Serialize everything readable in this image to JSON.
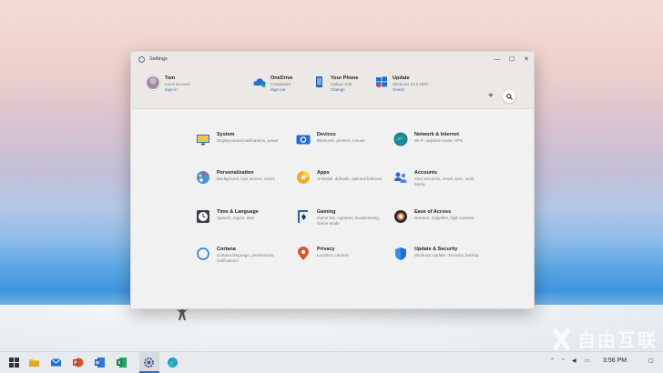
{
  "window": {
    "title": "Settings",
    "controls": {
      "minimize": "—",
      "maximize": "☐",
      "close": "✕"
    }
  },
  "header": {
    "user": {
      "name": "Tom",
      "account_type": "Local account",
      "link": "Sign in"
    },
    "items": [
      {
        "name": "OneDrive",
        "status": "Completed",
        "link": "Sign out"
      },
      {
        "name": "Your Phone",
        "status": "Galaxy S20",
        "link": "Change"
      },
      {
        "name": "Update",
        "status": "Windows 10.0.1807",
        "link": "Check"
      }
    ],
    "add_label": "+",
    "search_icon": "search-icon"
  },
  "categories": [
    {
      "name": "System",
      "desc": "Display,sound,notifications, power",
      "icon": "system-icon"
    },
    {
      "name": "Devices",
      "desc": "Bluetooth, printers, mouse",
      "icon": "devices-icon"
    },
    {
      "name": "Network & Internet",
      "desc": "Wi-Fi, airplane mode, VPN",
      "icon": "network-icon"
    },
    {
      "name": "Personalization",
      "desc": "Background, lock screen, colors",
      "icon": "personalization-icon"
    },
    {
      "name": "Apps",
      "desc": "Uninstall, defaults, optional features",
      "icon": "apps-icon"
    },
    {
      "name": "Accounts",
      "desc": "Your accounts, email, sync, work, family",
      "icon": "accounts-icon"
    },
    {
      "name": "Time & Language",
      "desc": "Speech, region, date",
      "icon": "time-language-icon"
    },
    {
      "name": "Gaming",
      "desc": "Game bar, captures, broadcasting, Game Mode",
      "icon": "gaming-icon"
    },
    {
      "name": "Ease of Access",
      "desc": "Narrator, magnifier, high contrast",
      "icon": "ease-of-access-icon"
    },
    {
      "name": "Cortana",
      "desc": "Cortana language, permissions, notifications",
      "icon": "cortana-icon"
    },
    {
      "name": "Privacy",
      "desc": "Location, camera",
      "icon": "privacy-icon"
    },
    {
      "name": "Update & Security",
      "desc": "Windows Update, recovery, backup",
      "icon": "update-security-icon"
    }
  ],
  "taskbar": {
    "apps": [
      "start-icon",
      "file-explorer-icon",
      "mail-icon",
      "powerpoint-icon",
      "word-icon",
      "excel-icon",
      "settings-icon",
      "edge-icon"
    ],
    "time": "3:56 PM"
  },
  "watermark": {
    "text": "自由互联"
  },
  "colors": {
    "accent": "#2b6cc4",
    "window_bg": "#f1f1f1",
    "header_bg": "#ece8e6",
    "taskbar": "#e7ebee"
  }
}
